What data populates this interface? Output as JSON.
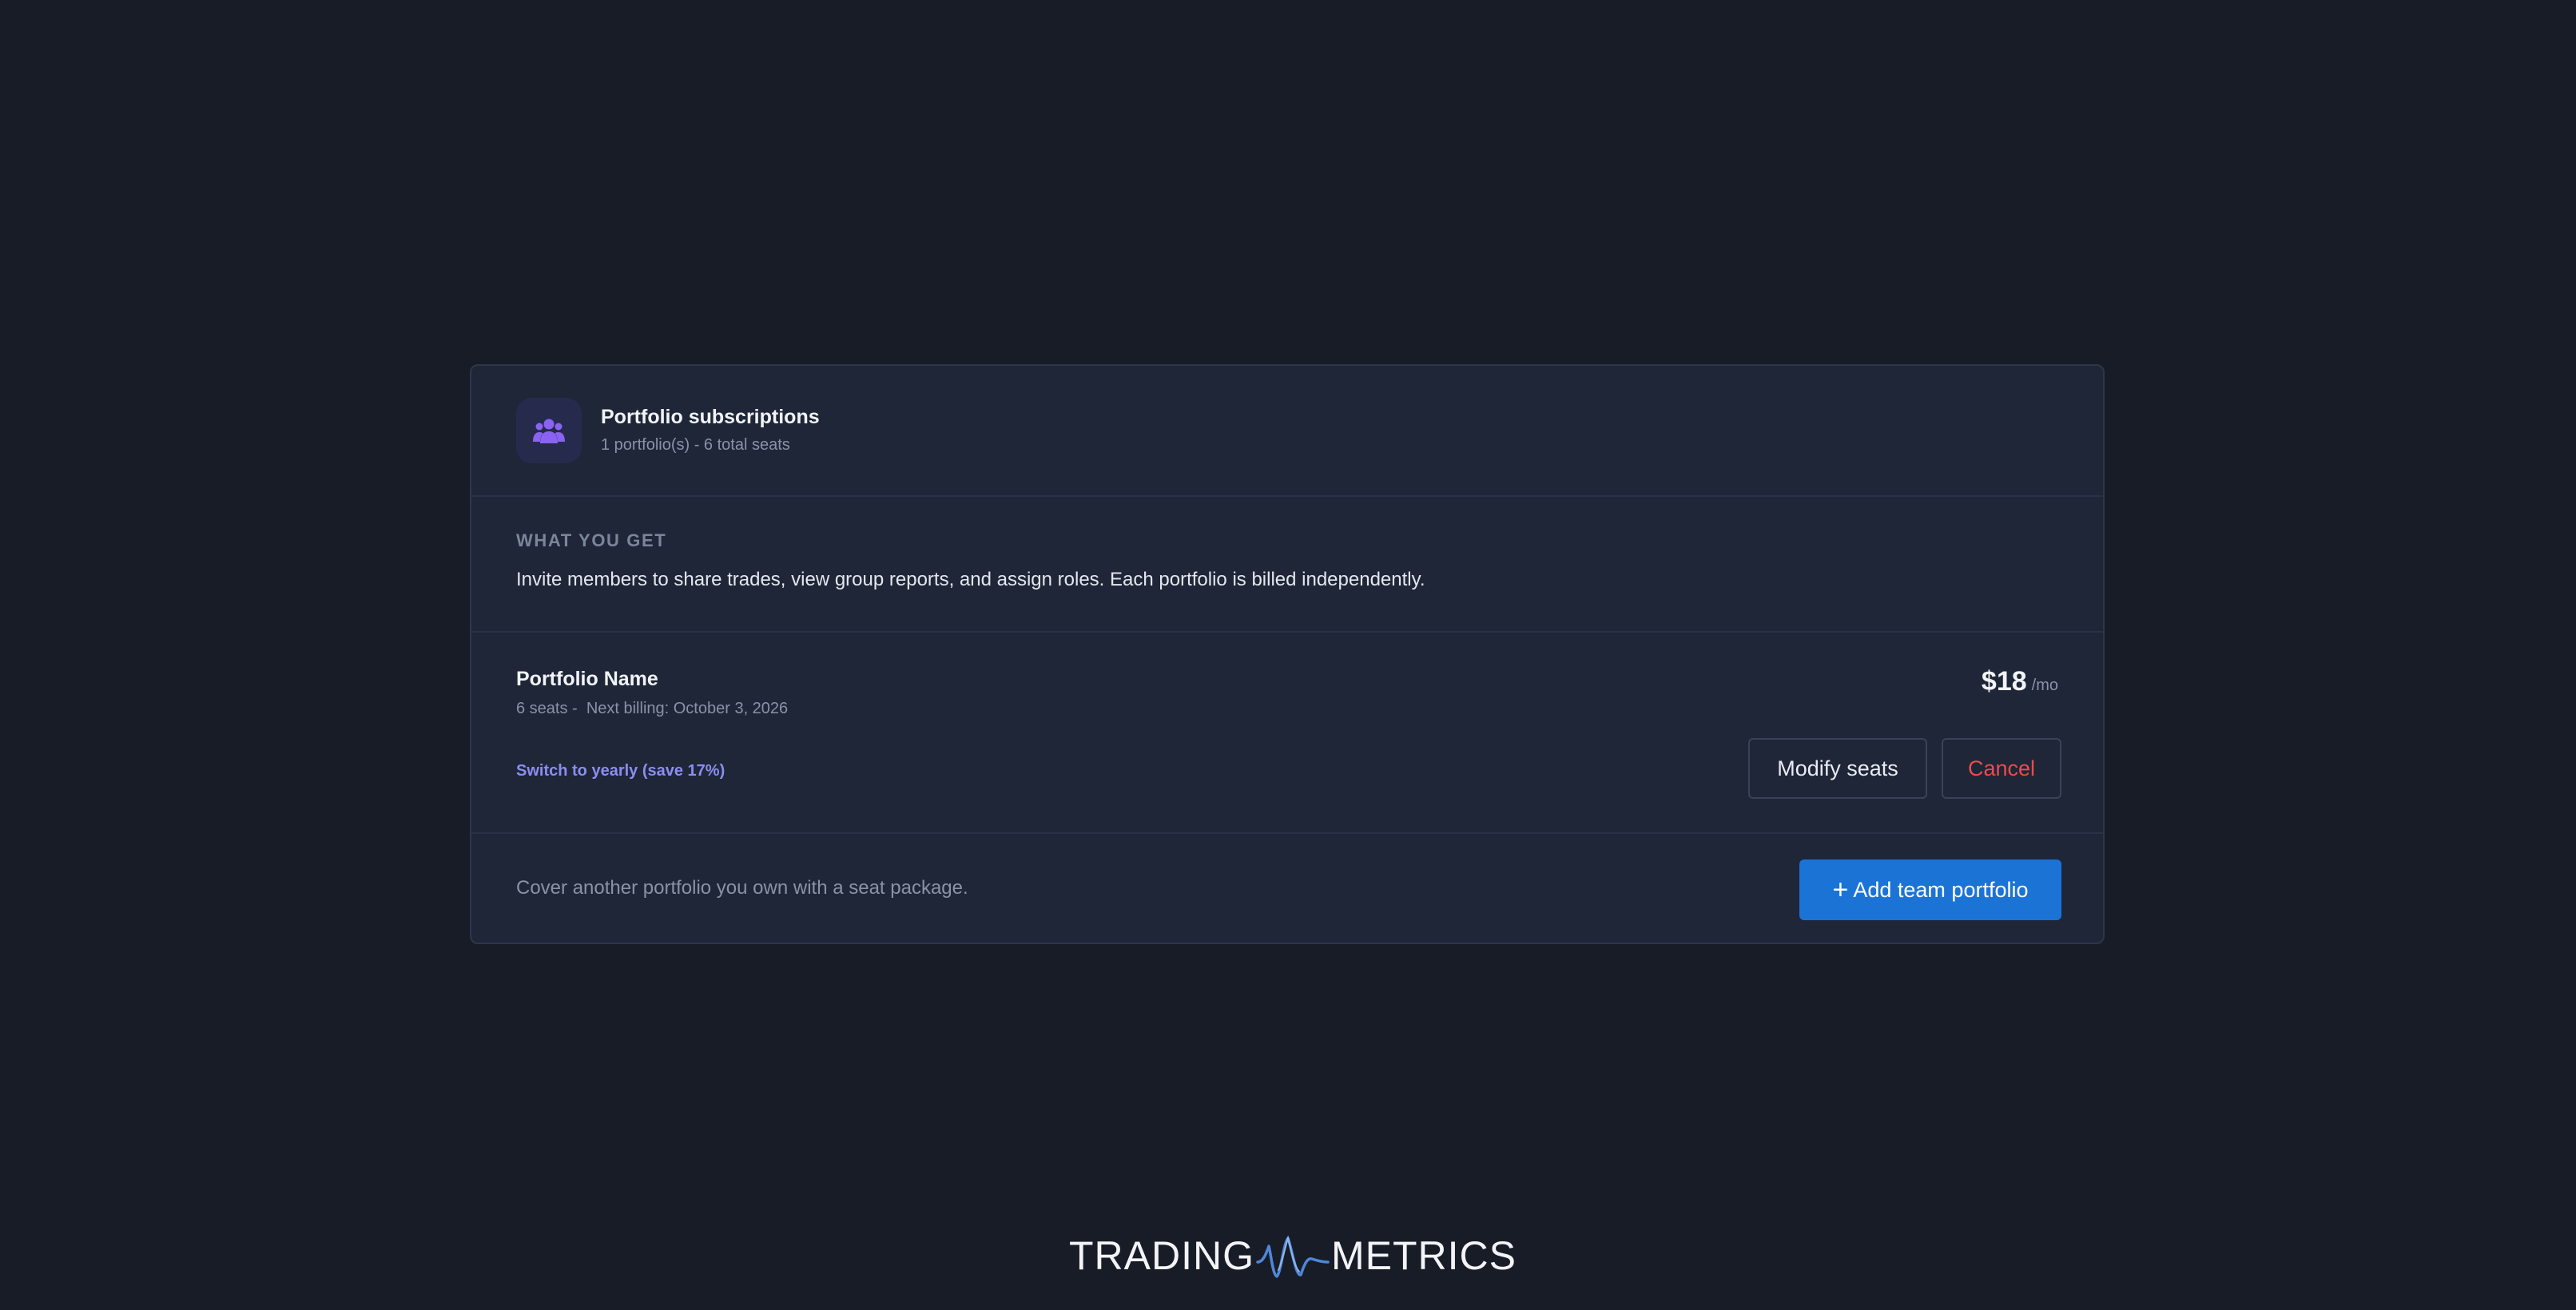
{
  "header": {
    "icon": "users-group-icon",
    "title": "Portfolio subscriptions",
    "subtitle": "1 portfolio(s) - 6 total seats"
  },
  "info": {
    "label": "WHAT YOU GET",
    "text": "Invite members to share trades, view group reports, and assign roles. Each portfolio is billed independently."
  },
  "subscription": {
    "name": "Portfolio Name",
    "meta": "6 seats -  Next billing: October 3, 2026",
    "price": "$18",
    "price_unit": "/mo",
    "switch_link": "Switch to yearly (save 17%)",
    "modify_label": "Modify seats",
    "cancel_label": "Cancel"
  },
  "footer": {
    "text": "Cover another portfolio you own with a seat package.",
    "add_icon": "plus-icon",
    "add_label": "Add team portfolio"
  },
  "logo": {
    "left": "TRADING",
    "right": "METRICS"
  },
  "colors": {
    "background": "#181c26",
    "card": "#1e2638",
    "accent_blue": "#1b73d6",
    "accent_purple": "#8b8ef0",
    "danger": "#ee4b4b"
  }
}
